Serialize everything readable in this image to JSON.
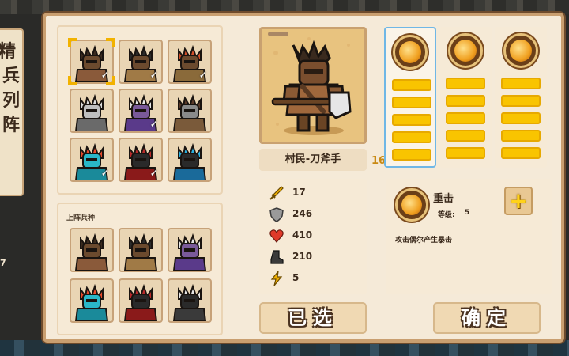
{
  "side_banner": {
    "title": "精兵列阵",
    "count": "7"
  },
  "roster": {
    "units": [
      {
        "id": "woodcutter",
        "checked": true,
        "selected": true,
        "skin": "#6b4a2e",
        "hair": "#3a2a1e",
        "armor": "#8a5a3a"
      },
      {
        "id": "rogue",
        "checked": true,
        "selected": false,
        "skin": "#6b4a2e",
        "hair": "#2a2a2a",
        "armor": "#a07a46"
      },
      {
        "id": "berserker",
        "checked": true,
        "selected": false,
        "skin": "#6b4a2e",
        "hair": "#d4502a",
        "armor": "#8a6a3a"
      },
      {
        "id": "hooded-monk",
        "checked": false,
        "selected": false,
        "skin": "#bfbfbf",
        "hair": "#dcdcdc",
        "armor": "#6a6a6a"
      },
      {
        "id": "dark-mage",
        "checked": true,
        "selected": false,
        "skin": "#7a5a9a",
        "hair": "#e6e6e6",
        "armor": "#5a3a8a"
      },
      {
        "id": "siege-cart",
        "checked": false,
        "selected": false,
        "skin": "#8a8a8a",
        "hair": "#5a3a2a",
        "armor": "#7a5a3a"
      },
      {
        "id": "sea-dragon",
        "checked": true,
        "selected": false,
        "skin": "#2ab8c8",
        "hair": "#e84a2a",
        "armor": "#1a8a9a"
      },
      {
        "id": "crimson-knight",
        "checked": true,
        "selected": false,
        "skin": "#2a2a2a",
        "hair": "#b82a2a",
        "armor": "#8a1a1a"
      },
      {
        "id": "azure-knight",
        "checked": false,
        "selected": false,
        "skin": "#2a2a2a",
        "hair": "#2ab0e0",
        "armor": "#1a6a9a"
      }
    ]
  },
  "deployed": {
    "label": "上阵兵种",
    "units": [
      {
        "id": "woodcutter",
        "skin": "#6b4a2e",
        "hair": "#3a2a1e",
        "armor": "#8a5a3a"
      },
      {
        "id": "rogue",
        "skin": "#6b4a2e",
        "hair": "#2a2a2a",
        "armor": "#a07a46"
      },
      {
        "id": "dark-mage",
        "skin": "#7a5a9a",
        "hair": "#e6e6e6",
        "armor": "#5a3a8a"
      },
      {
        "id": "sea-dragon",
        "skin": "#2ab8c8",
        "hair": "#e84a2a",
        "armor": "#1a8a9a"
      },
      {
        "id": "crimson-knight",
        "skin": "#2a2a2a",
        "hair": "#b82a2a",
        "armor": "#8a1a1a"
      },
      {
        "id": "skeleton-knight",
        "skin": "#2a2a2a",
        "hair": "#e6e6e6",
        "armor": "#3a3a3a"
      }
    ]
  },
  "unit_detail": {
    "name": "村民-刀斧手",
    "level": "16",
    "stats": [
      {
        "icon": "sword-icon",
        "value": "17",
        "color": "#f2b200"
      },
      {
        "icon": "shield-icon",
        "value": "246",
        "color": "#9a9a9a"
      },
      {
        "icon": "heart-icon",
        "value": "410",
        "color": "#e03a2a"
      },
      {
        "icon": "boot-icon",
        "value": "210",
        "color": "#3a3a3a"
      },
      {
        "icon": "lightning-icon",
        "value": "5",
        "color": "#f2b200"
      }
    ]
  },
  "skills": [
    {
      "icon": "heavy-strike-icon",
      "selected": true,
      "bars": 5
    },
    {
      "icon": "whirlwind-icon",
      "selected": false,
      "bars": 5
    },
    {
      "icon": "shield-buff-icon",
      "selected": false,
      "bars": 5
    }
  ],
  "skill_detail": {
    "name": "重击",
    "level_label": "等级:",
    "level": "5",
    "description": "攻击偶尔产生暴击"
  },
  "buttons": {
    "selected": "已选",
    "confirm": "确定"
  },
  "colors": {
    "accent": "#f2b200",
    "panel": "#f5ead8",
    "border": "#c99f70",
    "selection": "#6fb7e6"
  }
}
